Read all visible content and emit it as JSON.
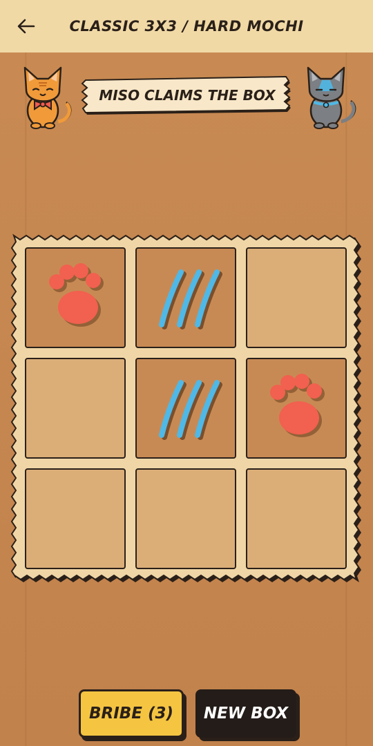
{
  "header": {
    "title": "CLASSIC 3X3 / HARD MOCHI",
    "back_icon": "arrow-left-icon"
  },
  "banner": {
    "text": "MISO CLAIMS THE BOX"
  },
  "players": {
    "left": {
      "icon": "orange-cat-icon",
      "color": "#f09a3a"
    },
    "right": {
      "icon": "gray-cat-icon",
      "color": "#7c7f83"
    }
  },
  "board": {
    "cells": [
      "paw",
      "scratch",
      "",
      "",
      "scratch",
      "paw",
      "",
      "",
      ""
    ],
    "paw_color": "#f2604f",
    "scratch_color": "#4fb8e6"
  },
  "actions": {
    "bribe_label": "BRIBE (3)",
    "new_label": "NEW BOX"
  }
}
